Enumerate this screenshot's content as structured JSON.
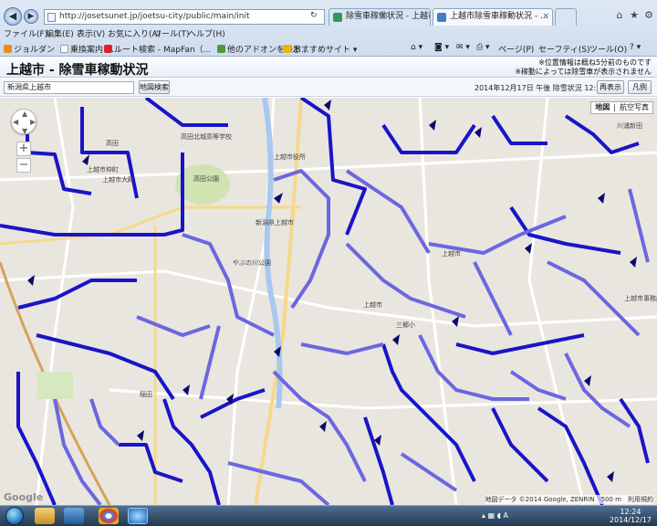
{
  "browser": {
    "address": "http://josetsunet.jp/joetsu-city/public/main/init",
    "tabs": [
      {
        "label": "除雪車稼働状況 - 上越市ホー..."
      },
      {
        "label": "上越市除雪車稼動状況 - ..."
      }
    ],
    "menu": [
      "ファイル(F)",
      "編集(E)",
      "表示(V)",
      "お気に入り(A)",
      "ツール(T)",
      "ヘルプ(H)"
    ],
    "favorites": [
      "ジョルダン",
      "乗換案内 - ...",
      "ルート検索 - MapFan（...",
      "他のアドオンを表示...",
      "おすすめサイト"
    ],
    "commands": [
      "ページ(P)",
      "セーフティ(S)",
      "ツール(O)"
    ]
  },
  "page": {
    "title": "上越市 - 除雪車稼動状況",
    "note1": "※位置情報は概ね5分前のものです",
    "note2": "※稼動によっては除雪車が表示されません",
    "place_input": "新潟県上越市",
    "search_button": "地図検索",
    "status": "2014年12月17日 午後 除雪状況 12:23 現在",
    "refresh_button": "再表示",
    "legend_button": "凡例"
  },
  "map": {
    "types": [
      "地図",
      "航空写真"
    ],
    "attribution": "地図データ ©2014 Google, ZENRIN　500 m　利用規約",
    "logo": "Google",
    "labels": [
      {
        "text": "高田北城高等学校"
      },
      {
        "text": "上越市仲町"
      },
      {
        "text": "上越市大町"
      },
      {
        "text": "高田公園"
      },
      {
        "text": "高田"
      },
      {
        "text": "新潟県上越市"
      },
      {
        "text": "上越市役所"
      },
      {
        "text": "やぶの川公園"
      },
      {
        "text": "三郷小"
      },
      {
        "text": "上越市"
      },
      {
        "text": "稲田"
      },
      {
        "text": "上越市事務組合"
      },
      {
        "text": "上越市"
      },
      {
        "text": "川浦新田"
      }
    ],
    "route_color": "#1a14c8",
    "route_color_light": "#6b67e0"
  },
  "taskbar": {
    "time": "12:24",
    "date": "2014/12/17"
  }
}
